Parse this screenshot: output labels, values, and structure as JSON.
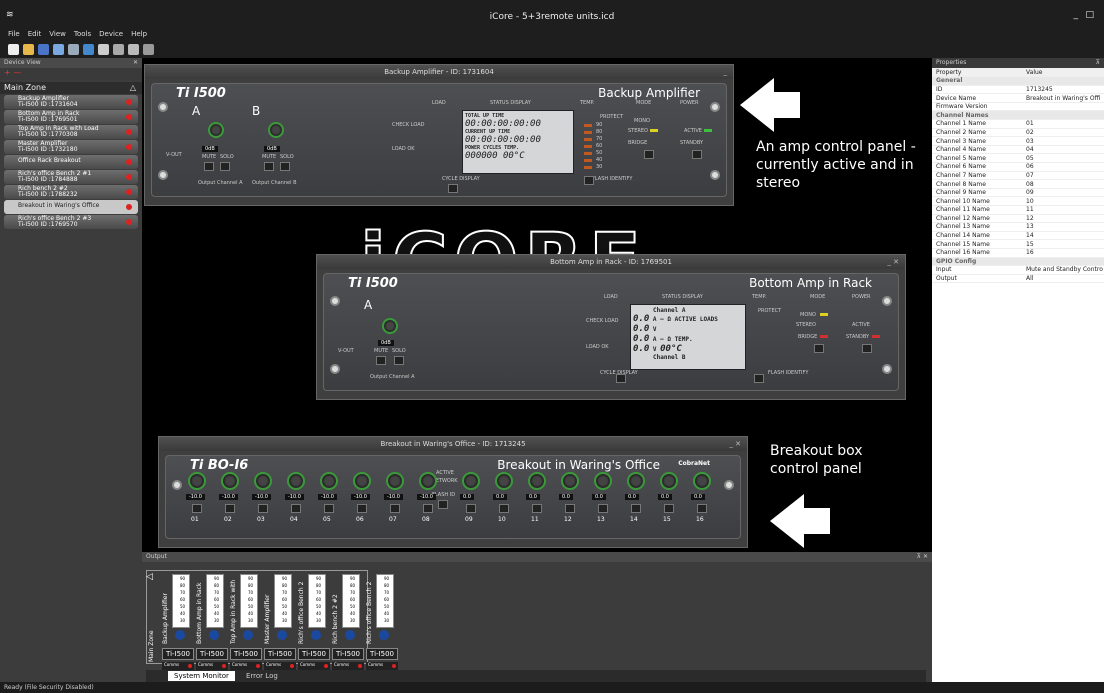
{
  "app": {
    "title": "iCore - 5+3remote units.icd"
  },
  "menu": [
    "File",
    "Edit",
    "View",
    "Tools",
    "Device",
    "Help"
  ],
  "device_view": {
    "title": "Device View",
    "zone": "Main Zone",
    "devices": [
      {
        "name": "Backup Amplifier",
        "model": "Ti-I500",
        "id": "ID :1731604"
      },
      {
        "name": "Bottom Amp in Rack",
        "model": "Ti-I500",
        "id": "ID :1769501"
      },
      {
        "name": "Top Amp in Rack with Load",
        "model": "Ti-I500",
        "id": "ID :1770308"
      },
      {
        "name": "Master Amplifier",
        "model": "Ti-I500",
        "id": "ID :1732180"
      },
      {
        "name": "Office Rack Breakout",
        "model": "",
        "id": ""
      },
      {
        "name": "Rich's office Bench 2 #1",
        "model": "Ti-I500",
        "id": "ID :1784888"
      },
      {
        "name": "Rich bench 2 #2",
        "model": "Ti-I500",
        "id": "ID :1788232"
      },
      {
        "name": "Breakout in Waring's Office",
        "model": "",
        "id": ""
      },
      {
        "name": "Rich's office Bench 2 #3",
        "model": "Ti-I500",
        "id": "ID :1769570"
      }
    ]
  },
  "windows": {
    "amp1": {
      "title": "Backup Amplifier - ID: 1731604",
      "brand": "Ti",
      "model": "I500",
      "name": "Backup Amplifier"
    },
    "amp2": {
      "title": "Bottom Amp in Rack - ID: 1769501",
      "brand": "Ti",
      "model": "I500",
      "name": "Bottom Amp in Rack"
    },
    "bo": {
      "title": "Breakout in Waring's Office - ID: 1713245",
      "brand": "Ti",
      "model": "BO-I6",
      "name": "Breakout in Waring's Office",
      "logo": "CobraNet"
    }
  },
  "amp_labels": {
    "load": "LOAD",
    "status": "STATUS DISPLAY",
    "temp": "TEMP.",
    "mode": "MODE",
    "power": "POWER",
    "total_up": "TOTAL UP TIME",
    "current_up": "CURRENT UP TIME",
    "power_cycles": "POWER CYCLES",
    "temp_short": "TEMP.",
    "time_val": "00:00:00:00:00",
    "cycles_val": "000000",
    "temp_val": "00°C",
    "protect": "PROTECT",
    "mono": "MONO",
    "stereo": "STEREO",
    "bridge": "BRIDGE",
    "active": "ACTIVE",
    "standby": "STANDBY",
    "flash": "FLASH IDENTIFY",
    "cycle": "CYCLE DISPLAY",
    "mute": "MUTE",
    "solo": "SOLO",
    "vout": "V-OUT",
    "out_a": "Output Channel A",
    "out_b": "Output Channel B",
    "check": "CHECK LOAD",
    "load_ok": "LOAD OK",
    "ch_a": "A",
    "ch_b": "B",
    "odb": "0dB",
    "channel_a": "Channel A",
    "channel_b": "Channel B",
    "active_loads": "ACTIVE LOADS",
    "amp_val": "0.0",
    "volt_val": "0.0",
    "temps": [
      "90",
      "80",
      "70",
      "60",
      "50",
      "40",
      "30"
    ]
  },
  "bo_labels": {
    "channels": [
      "01",
      "02",
      "03",
      "04",
      "05",
      "06",
      "07",
      "08",
      "09",
      "10",
      "11",
      "12",
      "13",
      "14",
      "15",
      "16"
    ],
    "level": "-10.0",
    "zero_level": "0.0",
    "active": "ACTIVE",
    "network": "NETWORK",
    "flash": "FLASH ID"
  },
  "callouts": {
    "c1": "An amp control panel - currently active and in stereo",
    "c2": "Breakout box control panel"
  },
  "properties": {
    "title": "Properties",
    "col_property": "Property",
    "col_value": "Value",
    "rows": [
      {
        "cat": "General"
      },
      {
        "k": "ID",
        "v": "1713245"
      },
      {
        "k": "Device Name",
        "v": "Breakout in Waring's Offi"
      },
      {
        "k": "Firmware Version",
        "v": ""
      },
      {
        "cat": "Channel Names"
      },
      {
        "k": "Channel 1 Name",
        "v": "01"
      },
      {
        "k": "Channel 2 Name",
        "v": "02"
      },
      {
        "k": "Channel 3 Name",
        "v": "03"
      },
      {
        "k": "Channel 4 Name",
        "v": "04"
      },
      {
        "k": "Channel 5 Name",
        "v": "05"
      },
      {
        "k": "Channel 6 Name",
        "v": "06"
      },
      {
        "k": "Channel 7 Name",
        "v": "07"
      },
      {
        "k": "Channel 8 Name",
        "v": "08"
      },
      {
        "k": "Channel 9 Name",
        "v": "09"
      },
      {
        "k": "Channel 10 Name",
        "v": "10"
      },
      {
        "k": "Channel 11 Name",
        "v": "11"
      },
      {
        "k": "Channel 12 Name",
        "v": "12"
      },
      {
        "k": "Channel 13 Name",
        "v": "13"
      },
      {
        "k": "Channel 14 Name",
        "v": "14"
      },
      {
        "k": "Channel 15 Name",
        "v": "15"
      },
      {
        "k": "Channel 16 Name",
        "v": "16"
      },
      {
        "cat": "GPIO Config"
      },
      {
        "k": "Input",
        "v": "Mute and Standby Contro"
      },
      {
        "k": "Output",
        "v": "All"
      }
    ]
  },
  "output": {
    "title": "Output",
    "zone": "Main Zone",
    "units": [
      {
        "name": "Backup Amplifier",
        "model": "Ti-I500"
      },
      {
        "name": "Bottom Amp in Rack",
        "model": "Ti-I500"
      },
      {
        "name": "Top Amp in Rack with",
        "model": "Ti-I500"
      },
      {
        "name": "Master Amplifier",
        "model": "Ti-I500"
      },
      {
        "name": "Rich's office Bench 2",
        "model": "Ti-I500"
      },
      {
        "name": "Rich bench 2 #2",
        "model": "Ti-I500"
      },
      {
        "name": "Rich's office Bench 2",
        "model": "Ti-I500"
      }
    ],
    "comms": "Comms",
    "scale": [
      "90",
      "80",
      "70",
      "60",
      "50",
      "40",
      "30"
    ],
    "tabs": [
      "System Monitor",
      "Error Log"
    ]
  },
  "status": {
    "text": "Ready (File Security Disabled)"
  }
}
